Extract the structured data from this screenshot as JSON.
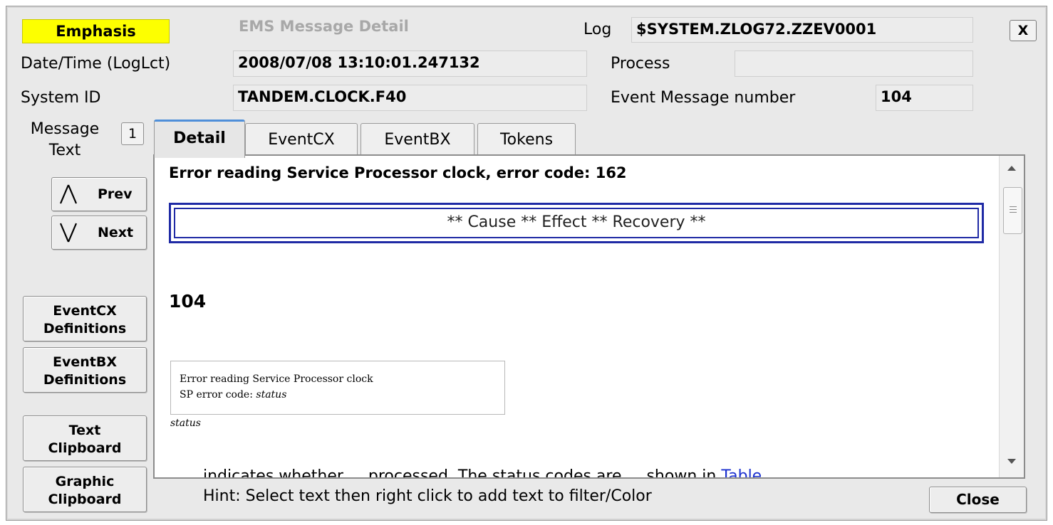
{
  "header": {
    "emphasis": "Emphasis",
    "title": "EMS Message Detail",
    "log_label": "Log",
    "log_value": "$SYSTEM.ZLOG72.ZZEV0001",
    "close_x": "X"
  },
  "fields": {
    "datetime_label": "Date/Time (LogLct)",
    "datetime_value": "2008/07/08 13:10:01.247132",
    "process_label": "Process",
    "process_value": "",
    "system_label": "System ID",
    "system_value": "TANDEM.CLOCK.F40",
    "event_label": "Event Message number",
    "event_value": "104"
  },
  "message_text": {
    "label_line1": "Message",
    "label_line2": "Text",
    "counter": "1"
  },
  "sidebar": {
    "prev": {
      "icon": "prev-arrow-icon",
      "glyph": "/\\",
      "label": "Prev"
    },
    "next": {
      "icon": "next-arrow-icon",
      "glyph": "\\/",
      "label": "Next"
    },
    "buttons": [
      {
        "line1": "EventCX",
        "line2": "Definitions"
      },
      {
        "line1": "EventBX",
        "line2": "Definitions"
      },
      {
        "line1": "Text",
        "line2": "Clipboard"
      },
      {
        "line1": "Graphic",
        "line2": "Clipboard"
      }
    ]
  },
  "tabs": [
    "Detail",
    "EventCX",
    "EventBX",
    "Tokens"
  ],
  "detail": {
    "heading": "Error reading Service Processor clock, error code: 162",
    "cer": "** Cause ** Effect ** Recovery **",
    "number": "104",
    "code_line1": "Error reading Service Processor clock",
    "code_line2_prefix": "SP error code: ",
    "code_line2_var": "status",
    "status_word": "status",
    "cut_text": "...  indicates whether ... processed. The status codes are ... shown in ",
    "cut_link": "Table ..."
  },
  "footer": {
    "hint": "Hint: Select text then right click to add text to filter/Color",
    "close": "Close"
  }
}
